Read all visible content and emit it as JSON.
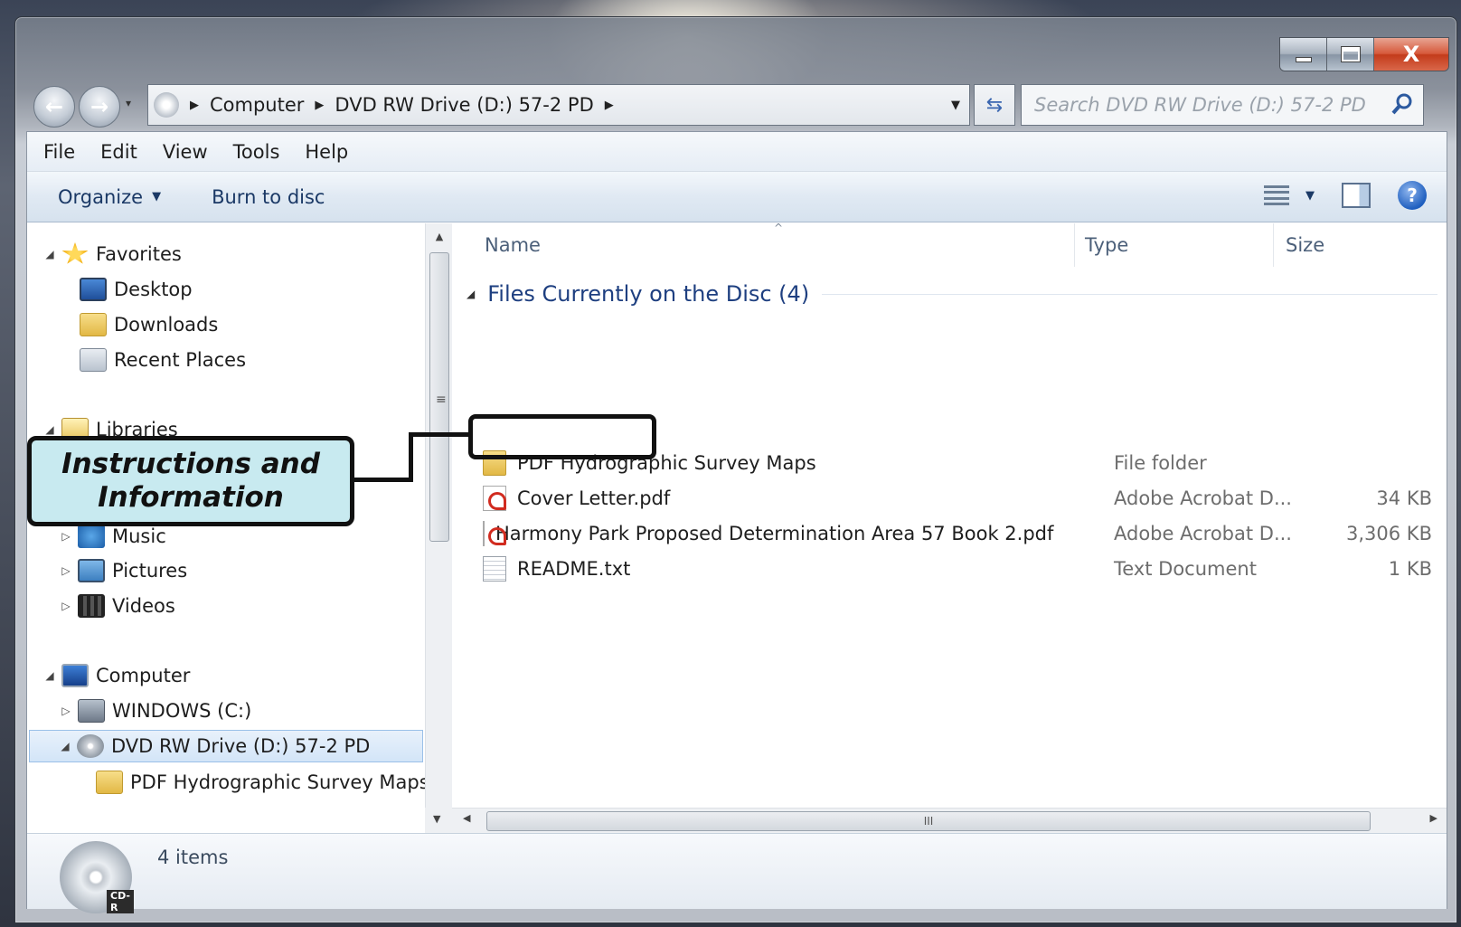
{
  "window": {
    "caption_buttons": {
      "minimize": "–",
      "maximize": "□",
      "close": "X"
    }
  },
  "address_bar": {
    "crumbs": [
      "Computer",
      "DVD RW Drive (D:) 57-2 PD"
    ],
    "search_placeholder": "Search DVD RW Drive (D:) 57-2 PD"
  },
  "menu": [
    "File",
    "Edit",
    "View",
    "Tools",
    "Help"
  ],
  "toolbar": {
    "organize": "Organize",
    "burn": "Burn to disc"
  },
  "nav_pane": {
    "items": [
      {
        "label": "Favorites",
        "icon": "star-icon"
      },
      {
        "label": "Desktop",
        "icon": "desktop-icon"
      },
      {
        "label": "Downloads",
        "icon": "downloads-folder-icon"
      },
      {
        "label": "Recent Places",
        "icon": "recent-places-icon"
      },
      {
        "label": "Libraries",
        "icon": "libraries-icon"
      },
      {
        "label": "Music",
        "icon": "music-icon"
      },
      {
        "label": "Pictures",
        "icon": "pictures-icon"
      },
      {
        "label": "Videos",
        "icon": "videos-icon"
      },
      {
        "label": "Computer",
        "icon": "computer-icon"
      },
      {
        "label": "WINDOWS (C:)",
        "icon": "drive-icon"
      },
      {
        "label": "DVD RW Drive (D:) 57-2 PD",
        "icon": "dvd-drive-icon"
      },
      {
        "label": "PDF Hydrographic Survey Maps",
        "icon": "folder-icon"
      }
    ]
  },
  "content": {
    "columns": {
      "name": "Name",
      "type": "Type",
      "size": "Size"
    },
    "group_title": "Files Currently on the Disc (4)",
    "files": [
      {
        "name": "PDF Hydrographic Survey Maps",
        "type": "File folder",
        "size": "",
        "icon": "folder-icon"
      },
      {
        "name": "Cover Letter.pdf",
        "type": "Adobe Acrobat D...",
        "size": "34 KB",
        "icon": "pdf-icon"
      },
      {
        "name": "Harmony Park Proposed Determination Area 57 Book 2.pdf",
        "type": "Adobe Acrobat D...",
        "size": "3,306 KB",
        "icon": "pdf-icon"
      },
      {
        "name": "README.txt",
        "type": "Text Document",
        "size": "1 KB",
        "icon": "text-file-icon"
      }
    ]
  },
  "details": {
    "items_count": "4 items",
    "disc_label": "CD-R"
  },
  "annotation": {
    "callout_text": "Instructions and Information"
  }
}
